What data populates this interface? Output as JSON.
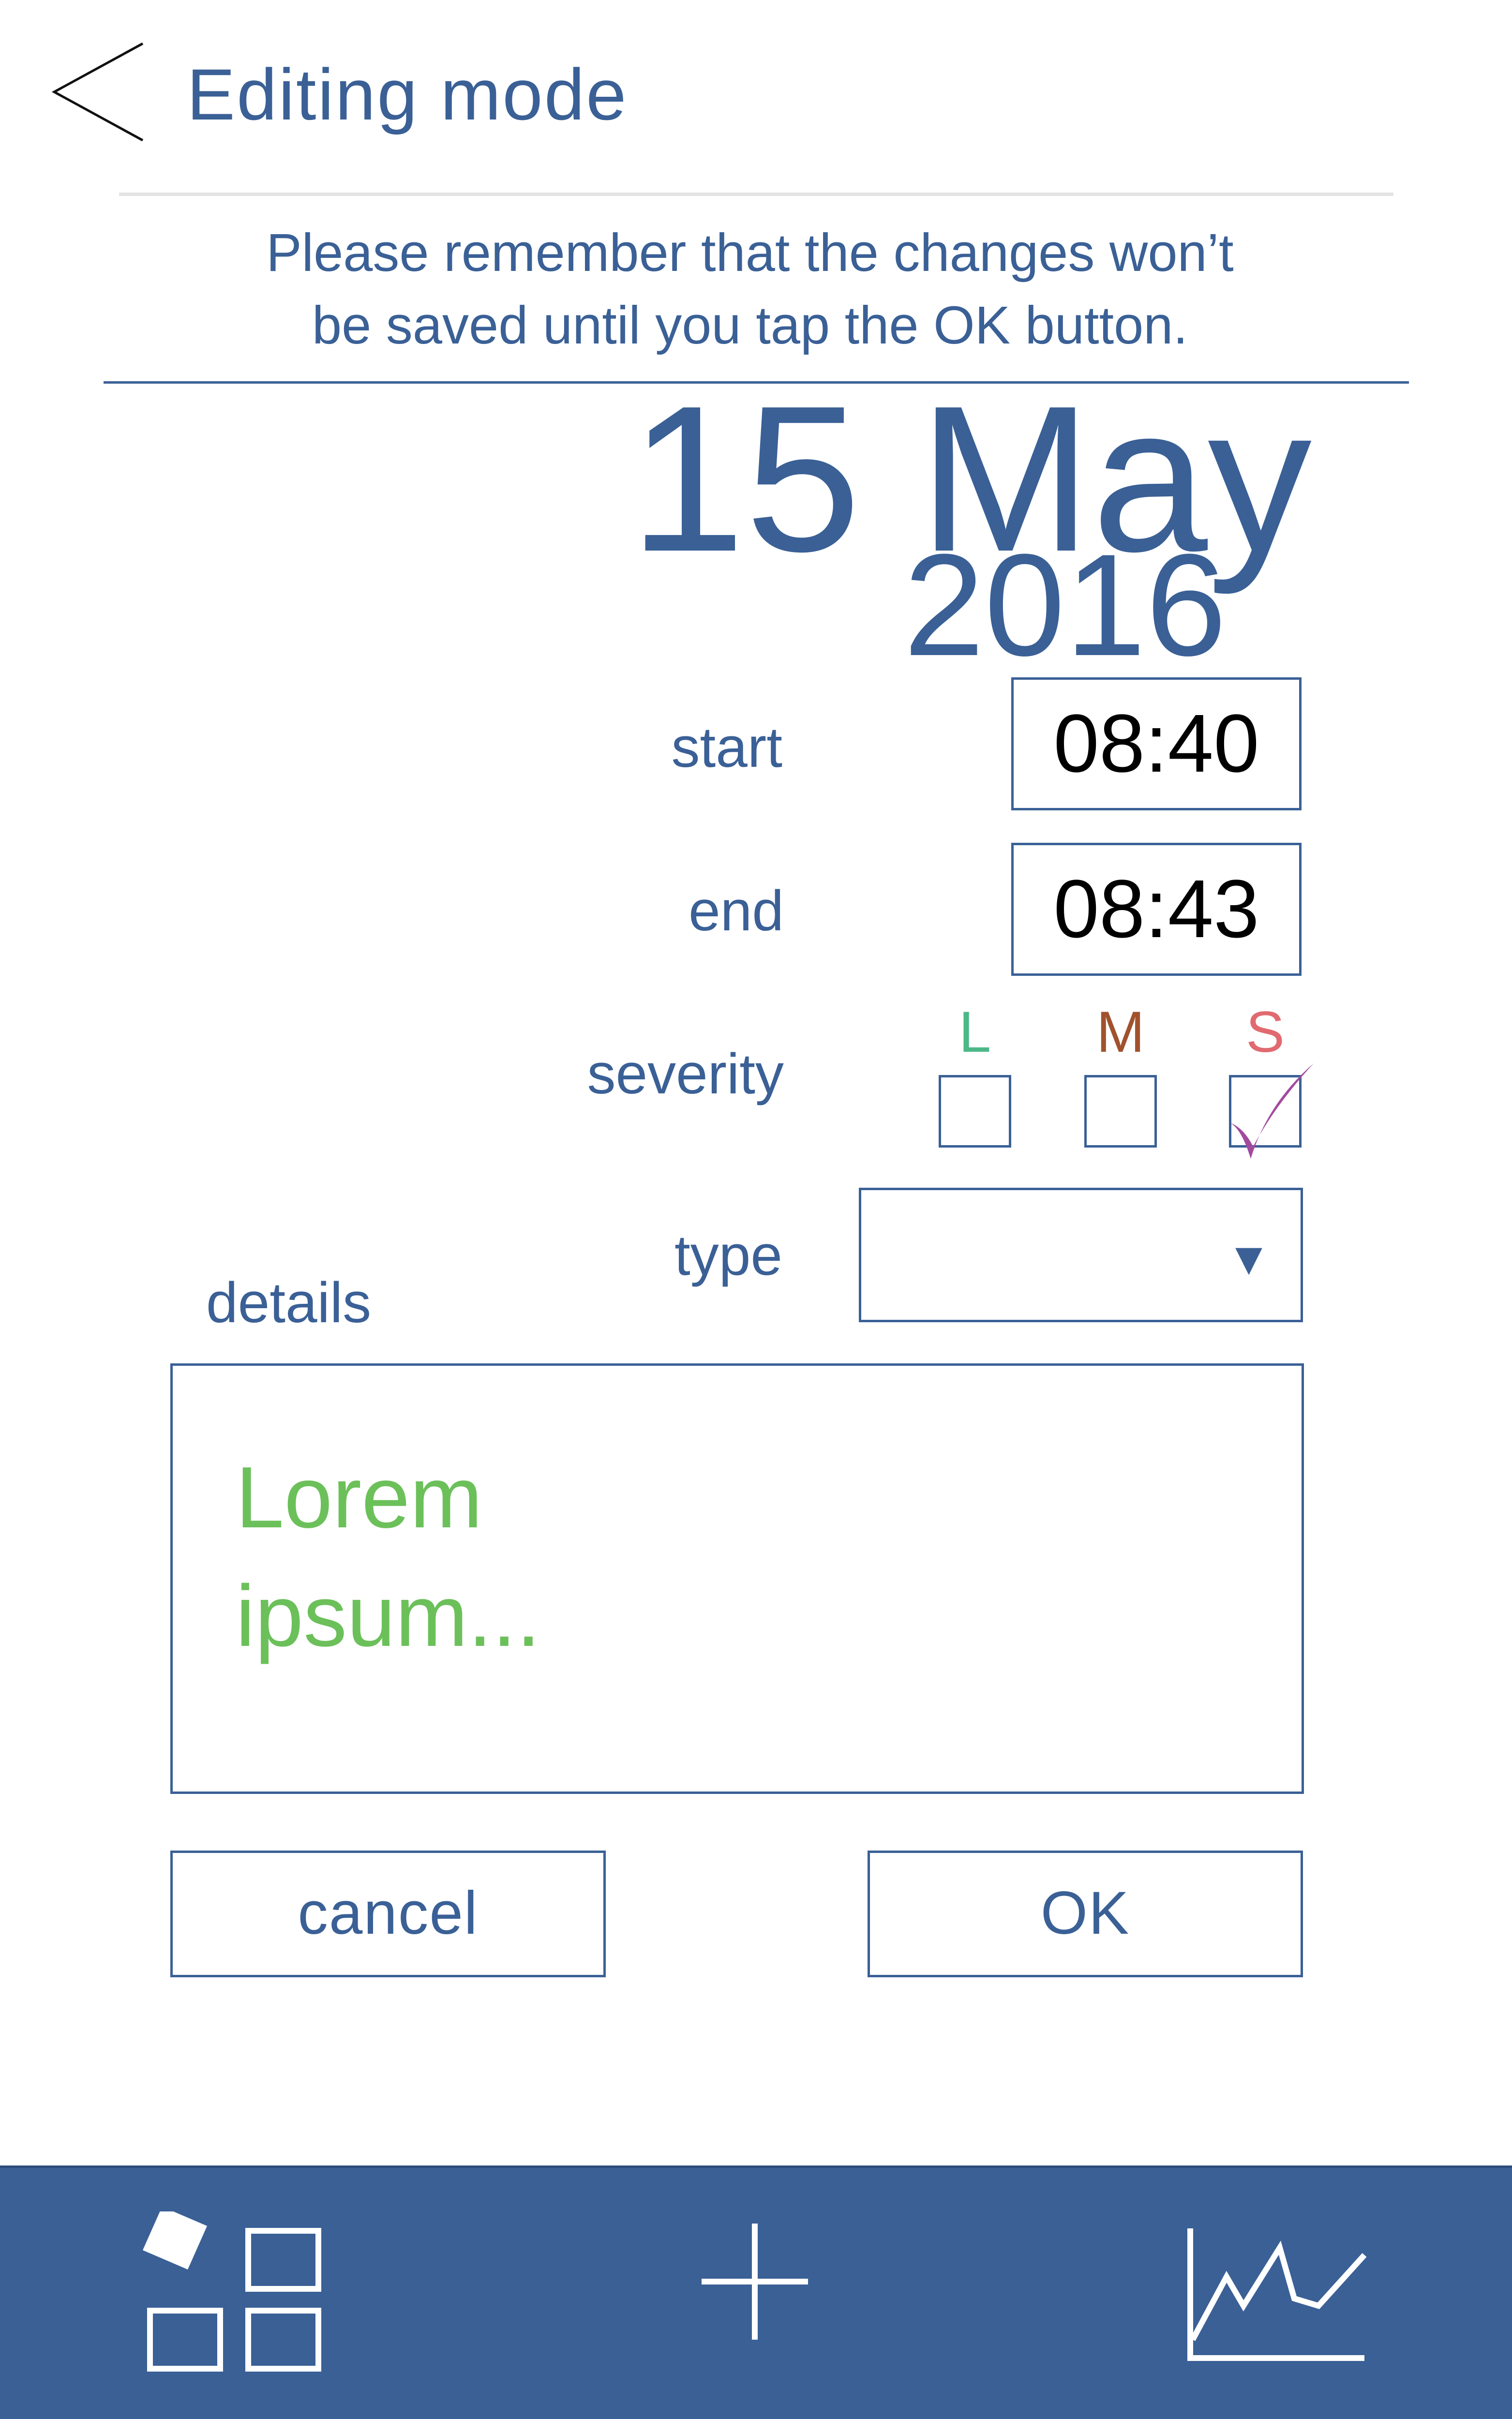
{
  "header": {
    "back_icon": "chevron-left-icon",
    "title": "Editing mode"
  },
  "notice": {
    "line1": "Please remember that the changes won’t",
    "line2": "be saved until you tap the OK button."
  },
  "date": {
    "day_month": "15 May",
    "year": "2016"
  },
  "form": {
    "start_label": "start",
    "start_value": "08:40",
    "end_label": "end",
    "end_value": "08:43",
    "severity_label": "severity",
    "severity": [
      {
        "letter": "L",
        "color": "#4cb887",
        "checked": false
      },
      {
        "letter": "M",
        "color": "#a0522d",
        "checked": false
      },
      {
        "letter": "S",
        "color": "#e06a70",
        "checked": true
      }
    ],
    "check_color": "#a24a9e",
    "type_label": "type",
    "type_value": "",
    "details_label": "details",
    "details_line1": "Lorem",
    "details_line2": "ipsum..."
  },
  "buttons": {
    "cancel": "cancel",
    "ok": "OK"
  },
  "navbar": {
    "items": [
      "dashboard-icon",
      "add-icon",
      "line-chart-icon"
    ],
    "background": "#3a6096"
  }
}
